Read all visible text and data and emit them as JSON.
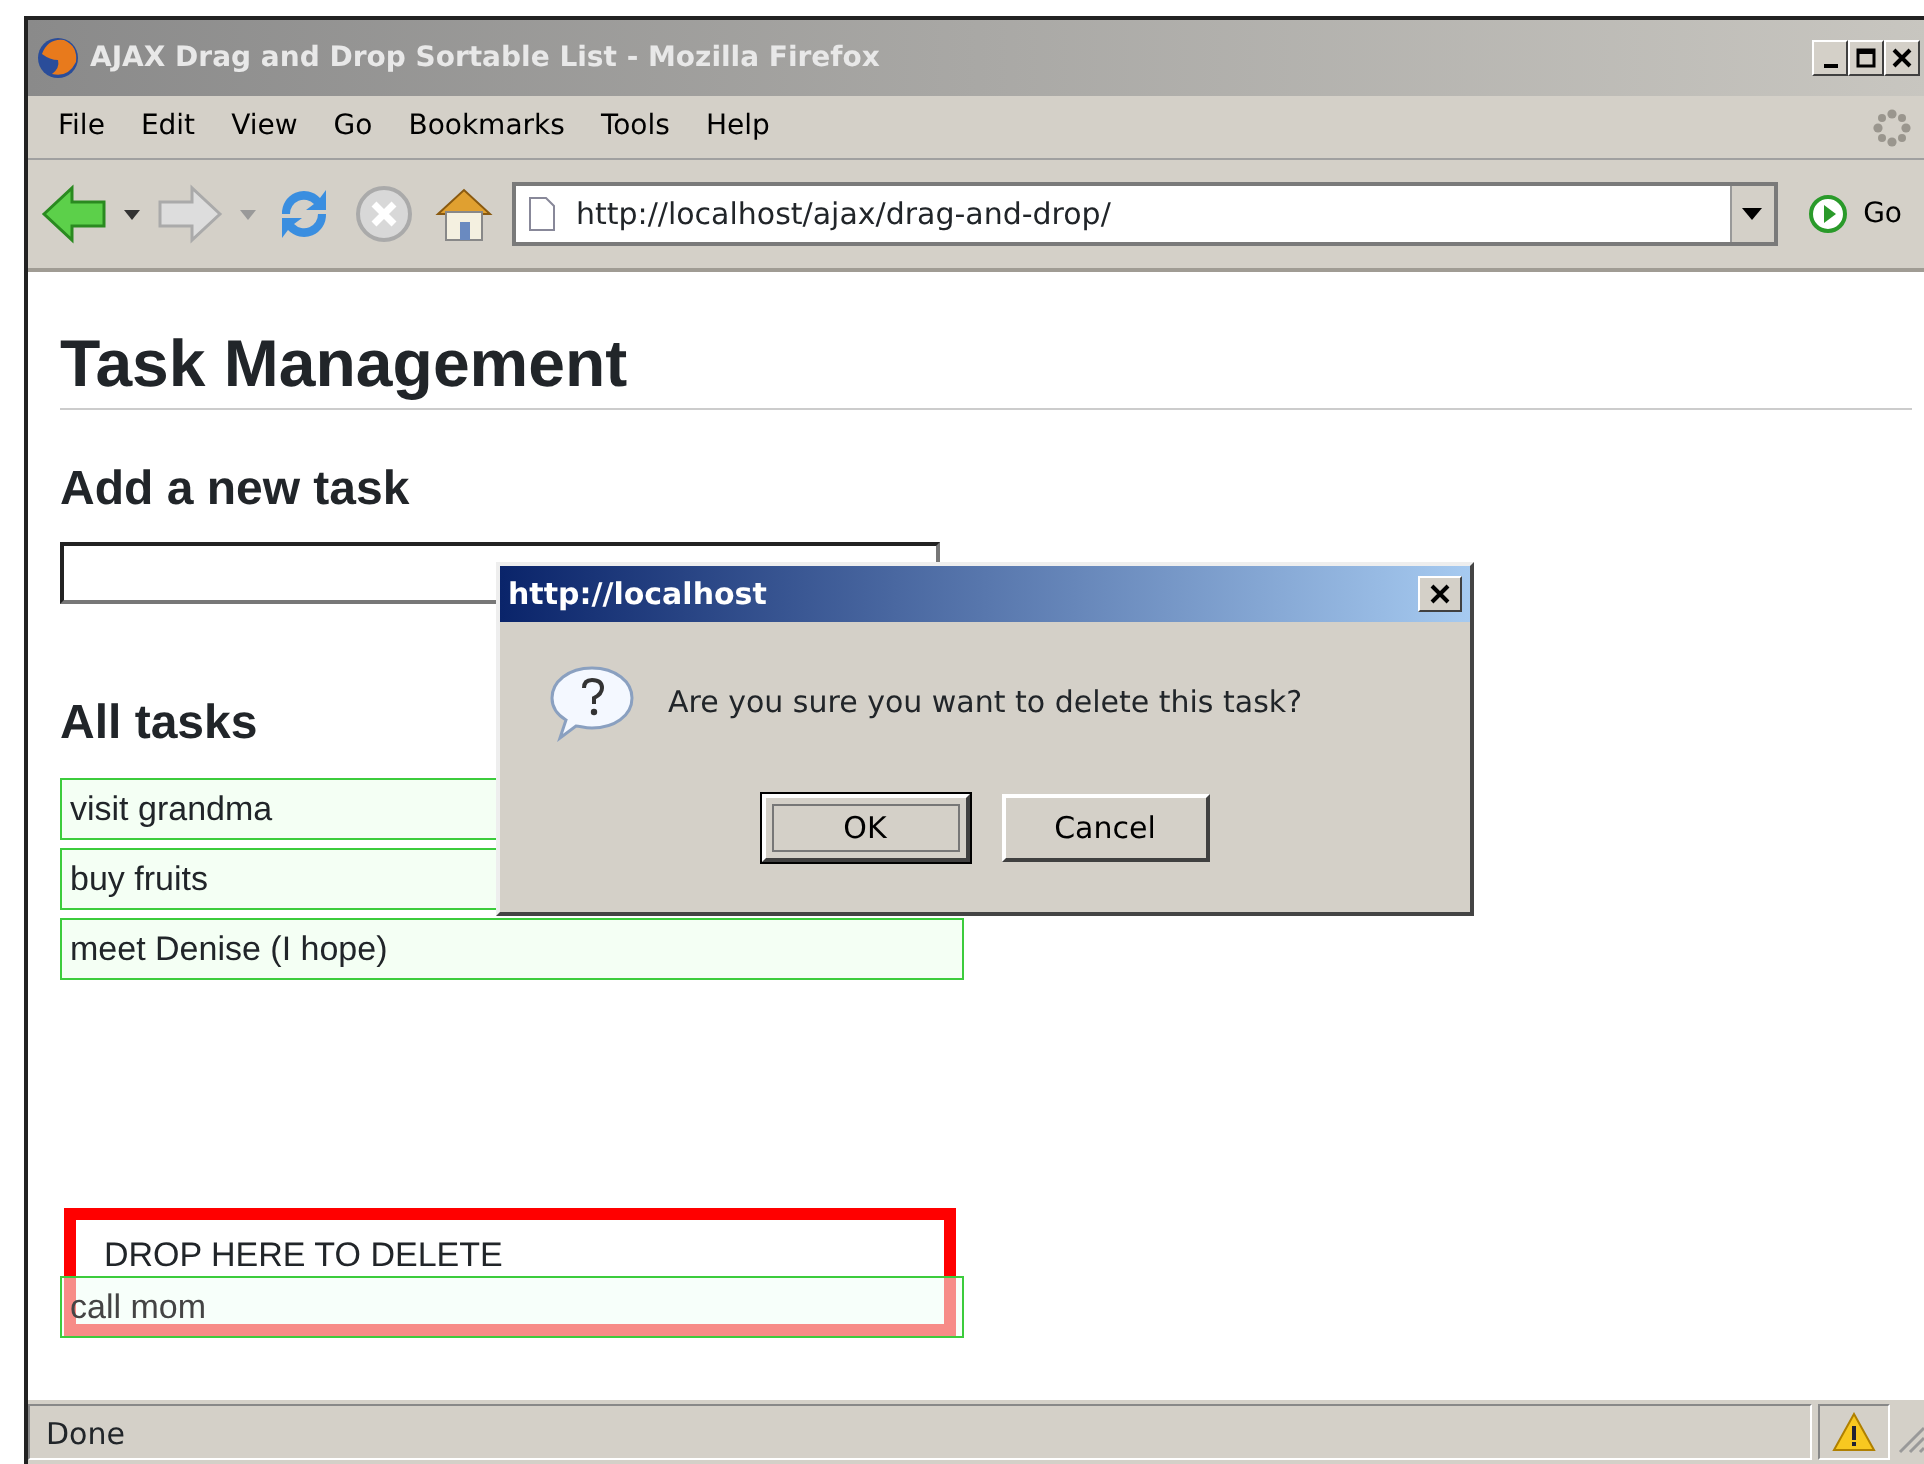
{
  "window": {
    "title": "AJAX Drag and Drop Sortable List - Mozilla Firefox"
  },
  "menu": [
    {
      "label": "File"
    },
    {
      "label": "Edit"
    },
    {
      "label": "View"
    },
    {
      "label": "Go"
    },
    {
      "label": "Bookmarks"
    },
    {
      "label": "Tools"
    },
    {
      "label": "Help"
    }
  ],
  "toolbar": {
    "address": "http://localhost/ajax/drag-and-drop/",
    "go_label": "Go"
  },
  "page": {
    "title": "Task Management",
    "add_heading": "Add a new task",
    "list_heading": "All tasks",
    "tasks": [
      {
        "label": "visit grandma"
      },
      {
        "label": "buy fruits"
      },
      {
        "label": "meet Denise (I hope)"
      }
    ],
    "drop_zone": "DROP HERE TO DELETE",
    "dragged_task": {
      "label": "call mom"
    }
  },
  "dialog": {
    "title": "http://localhost",
    "message": "Are you sure you want to delete this task?",
    "buttons": [
      {
        "label": "OK",
        "focused": true
      },
      {
        "label": "Cancel",
        "focused": false
      }
    ]
  },
  "status_bar": {
    "text": "Done"
  }
}
